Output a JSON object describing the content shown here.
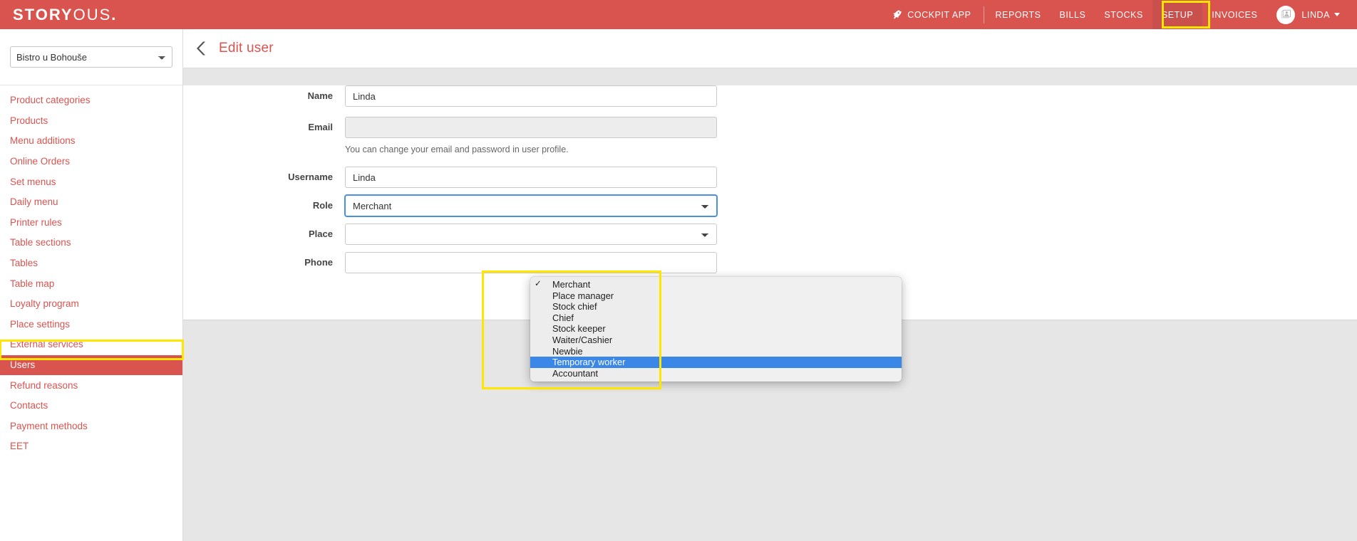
{
  "brand": {
    "logo_bold": "STORY",
    "logo_light": "OUS",
    "logo_dot": ".",
    "primary_color": "#d9534f",
    "highlight_color": "#ffe500",
    "selection_color": "#3a87e8"
  },
  "topnav": {
    "cockpit_icon": "rocket-icon",
    "items": [
      {
        "label": "COCKPIT APP",
        "active": false
      },
      {
        "label": "REPORTS",
        "active": false
      },
      {
        "label": "BILLS",
        "active": false
      },
      {
        "label": "STOCKS",
        "active": false
      },
      {
        "label": "SETUP",
        "active": true
      },
      {
        "label": "INVOICES",
        "active": false
      }
    ],
    "user": {
      "name": "LINDA",
      "avatar_icon": "user-id-card-icon",
      "caret_icon": "caret-down-icon"
    }
  },
  "sidebar": {
    "place_select": {
      "value": "Bistro u Bohouše",
      "options": [
        "Bistro u Bohouše"
      ]
    },
    "items": [
      {
        "label": "Product categories",
        "active": false
      },
      {
        "label": "Products",
        "active": false
      },
      {
        "label": "Menu additions",
        "active": false
      },
      {
        "label": "Online Orders",
        "active": false
      },
      {
        "label": "Set menus",
        "active": false
      },
      {
        "label": "Daily menu",
        "active": false
      },
      {
        "label": "Printer rules",
        "active": false
      },
      {
        "label": "Table sections",
        "active": false
      },
      {
        "label": "Tables",
        "active": false
      },
      {
        "label": "Table map",
        "active": false
      },
      {
        "label": "Loyalty program",
        "active": false
      },
      {
        "label": "Place settings",
        "active": false
      },
      {
        "label": "External services",
        "active": false
      },
      {
        "label": "Users",
        "active": true
      },
      {
        "label": "Refund reasons",
        "active": false
      },
      {
        "label": "Contacts",
        "active": false
      },
      {
        "label": "Payment methods",
        "active": false
      },
      {
        "label": "EET",
        "active": false
      }
    ]
  },
  "page": {
    "back_icon": "chevron-left-icon",
    "title": "Edit user"
  },
  "form": {
    "name": {
      "label": "Name",
      "value": "Linda"
    },
    "email": {
      "label": "Email",
      "value": "",
      "help": "You can change your email and password in user profile."
    },
    "username": {
      "label": "Username",
      "value": "Linda"
    },
    "role": {
      "label": "Role",
      "value": "Merchant"
    },
    "place": {
      "label": "Place",
      "value": ""
    },
    "phone": {
      "label": "Phone",
      "value": ""
    }
  },
  "role_dropdown": {
    "open": true,
    "items": [
      {
        "label": "Merchant",
        "checked": true,
        "selected": false
      },
      {
        "label": "Place manager",
        "checked": false,
        "selected": false
      },
      {
        "label": "Stock chief",
        "checked": false,
        "selected": false
      },
      {
        "label": "Chief",
        "checked": false,
        "selected": false
      },
      {
        "label": "Stock keeper",
        "checked": false,
        "selected": false
      },
      {
        "label": "Waiter/Cashier",
        "checked": false,
        "selected": false
      },
      {
        "label": "Newbie",
        "checked": false,
        "selected": false
      },
      {
        "label": "Temporary worker",
        "checked": false,
        "selected": true
      },
      {
        "label": "Accountant",
        "checked": false,
        "selected": false
      }
    ]
  }
}
